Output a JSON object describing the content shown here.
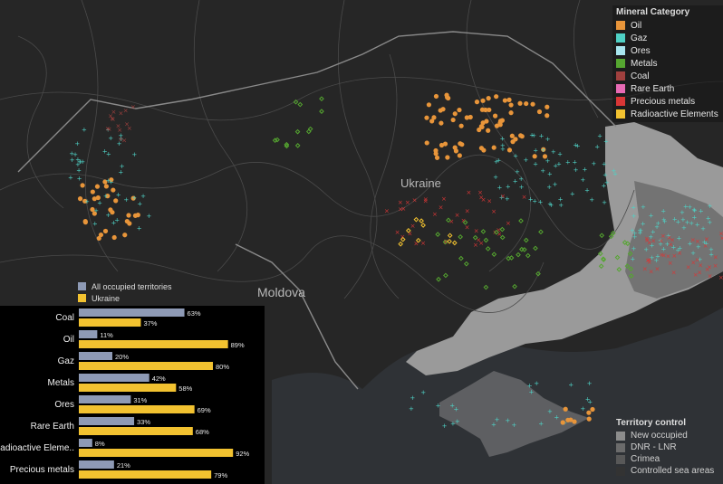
{
  "map": {
    "country_labels": {
      "ukraine": "Ukraine",
      "moldova": "Moldova"
    }
  },
  "legend": {
    "title": "Mineral Category",
    "items": [
      {
        "label": "Oil",
        "color": "#e8953a"
      },
      {
        "label": "Gaz",
        "color": "#4fd1c5"
      },
      {
        "label": "Ores",
        "color": "#a8e6ef"
      },
      {
        "label": "Metals",
        "color": "#55a630"
      },
      {
        "label": "Coal",
        "color": "#a0403e"
      },
      {
        "label": "Rare Earth",
        "color": "#e86ab4"
      },
      {
        "label": "Precious metals",
        "color": "#d93636"
      },
      {
        "label": "Radioactive Elements",
        "color": "#f2c230"
      }
    ]
  },
  "territory_control": {
    "title": "Territory control",
    "items": [
      {
        "label": "New occupied",
        "color": "#8c8c8c"
      },
      {
        "label": "DNR - LNR",
        "color": "#6b6b6b"
      },
      {
        "label": "Crimea",
        "color": "#585858"
      },
      {
        "label": "Controlled sea areas",
        "color": "#333333"
      }
    ]
  },
  "chart_data": {
    "type": "bar",
    "categories": [
      "Coal",
      "Oil",
      "Gaz",
      "Metals",
      "Ores",
      "Rare Earth",
      "Radioactive Eleme..",
      "Precious metals"
    ],
    "series": [
      {
        "name": "All occupied territories",
        "color": "#8e9ab5",
        "values": [
          63,
          11,
          20,
          42,
          31,
          33,
          8,
          21
        ],
        "labels": [
          "63%",
          "11%",
          "20%",
          "42%",
          "31%",
          "33%",
          "8%",
          "21%"
        ]
      },
      {
        "name": "Ukraine",
        "color": "#f2c230",
        "values": [
          37,
          89,
          80,
          58,
          69,
          68,
          92,
          79
        ],
        "labels": [
          "37%",
          "89%",
          "80%",
          "58%",
          "69%",
          "68%",
          "92%",
          "79%"
        ]
      }
    ],
    "xlim": [
      0,
      100
    ]
  }
}
